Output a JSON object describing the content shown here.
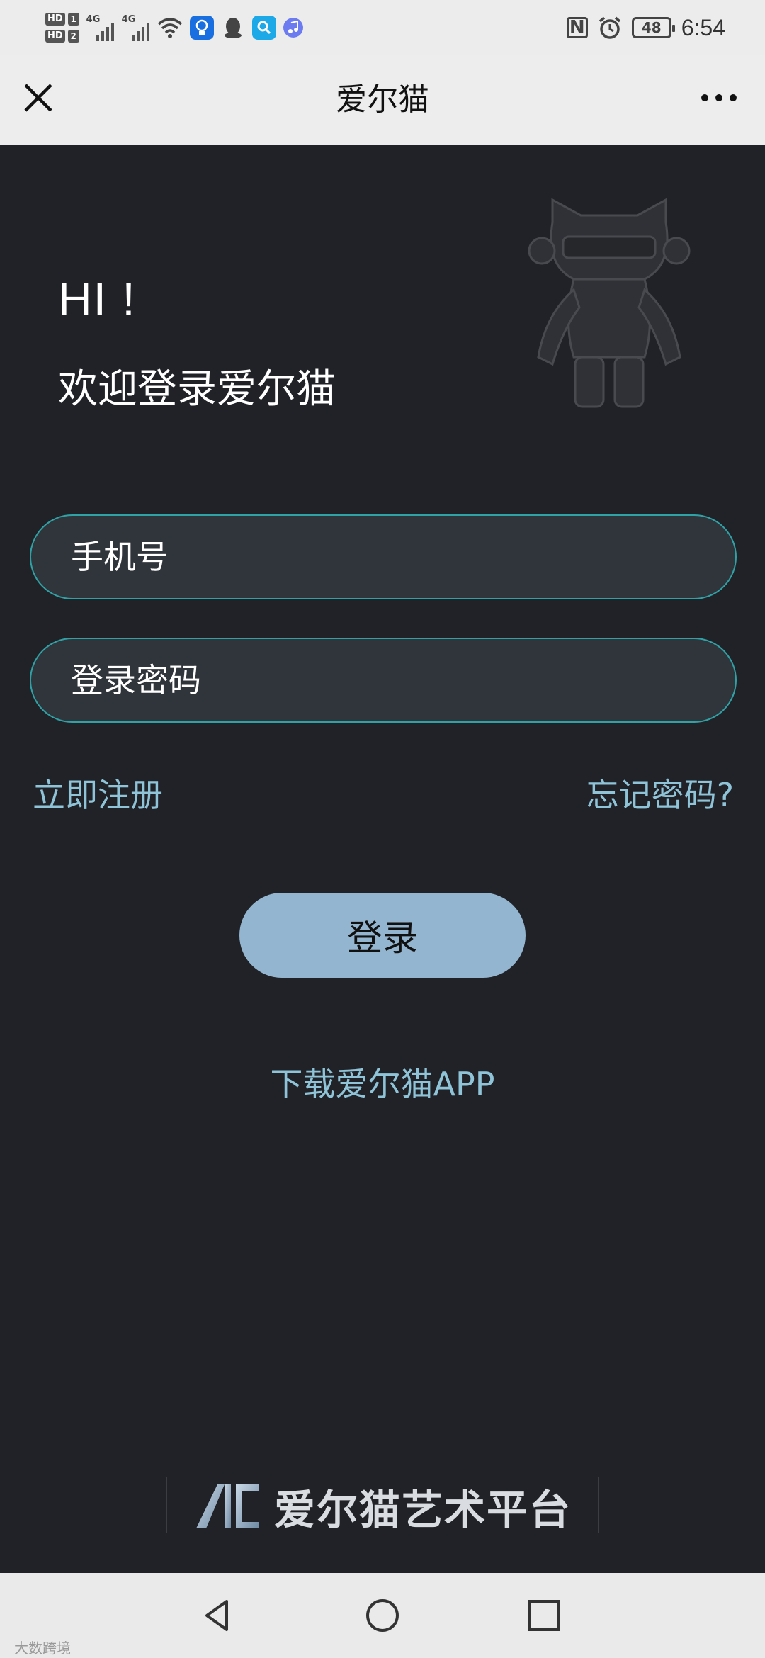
{
  "status_bar": {
    "hd1_label": "HD",
    "hd1_num": "1",
    "hd2_label": "HD",
    "hd2_num": "2",
    "network1": "4G",
    "network2": "4G",
    "nfc_label": "N",
    "battery": "48",
    "time": "6:54"
  },
  "nav": {
    "title": "爱尔猫"
  },
  "login": {
    "greeting": "HI !",
    "welcome": "欢迎登录爱尔猫",
    "phone_placeholder": "手机号",
    "password_placeholder": "登录密码",
    "register_label": "立即注册",
    "forgot_label": "忘记密码?",
    "login_button": "登录",
    "download_label": "下载爱尔猫APP"
  },
  "brand": {
    "name": "爱尔猫艺术平台"
  },
  "system_nav": {
    "watermark": "大数跨境"
  },
  "colors": {
    "background": "#202227",
    "accent_border": "#2fa2a6",
    "link": "#8fc4d8",
    "button": "#93b5cf"
  },
  "icons": [
    "close-icon",
    "more-icon",
    "mascot-image",
    "back-icon",
    "home-icon",
    "recent-apps-icon"
  ]
}
